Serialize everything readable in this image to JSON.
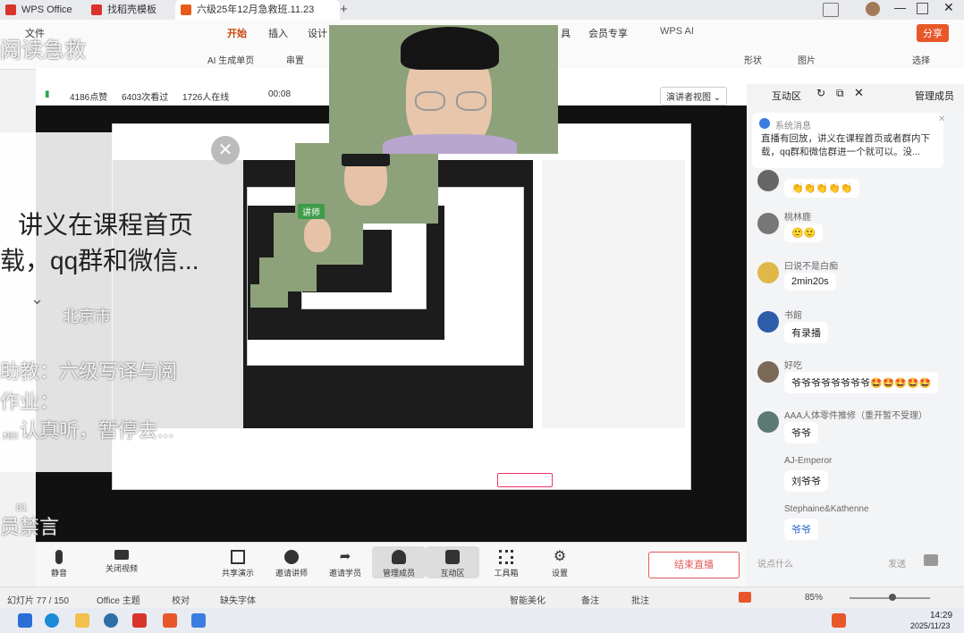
{
  "wps_tabs": [
    {
      "label": "WPS Office",
      "color": "#d9342b"
    },
    {
      "label": "找稻壳模板",
      "color": "#d9342b"
    },
    {
      "label": "六级25年12月急救班.11.23",
      "color": "#e85a1b"
    }
  ],
  "ribbon": {
    "menu_label": "文件",
    "tabs": [
      "开始",
      "插入",
      "设计",
      "具",
      "会员专享",
      "WPS AI"
    ],
    "tools": [
      "AI 生成单页",
      "串置",
      "形状",
      "图片",
      "选择"
    ],
    "share": "分享"
  },
  "live": {
    "likes": "4186点赞",
    "views": "6403次看过",
    "online": "1726人在线",
    "timer": "00:08",
    "view_mode": "演讲者视图",
    "panel_title": "互动区",
    "members_tab": "管理成员"
  },
  "teacher_tag": "讲师",
  "overlay": {
    "title_fragment": "阅读急救",
    "line1": "讲义在课程首页",
    "line2": "载，qq群和微信...",
    "ghost_city": "北京市",
    "ghost_line1": "助教：六级写译与阅",
    "ghost_line2": "作业：",
    "ghost_line3": "，认真听，暂停去...",
    "ghost_muted": "员禁言",
    "ghost_num1": "80",
    "ghost_num2": "81"
  },
  "system_msg": {
    "label": "系统消息",
    "text": "直播有回放，讲义在课程首页或者群内下载，qq群和微信群进一个就可以。没..."
  },
  "chat": [
    {
      "name": "",
      "text": "👏👏👏👏👏",
      "avatar": "#666"
    },
    {
      "name": "桃林鹿",
      "text": "🙂🙂",
      "avatar": "#777"
    },
    {
      "name": "曰说不是白痴",
      "text": "2min20s",
      "avatar": "#e0b84a"
    },
    {
      "name": "书館",
      "text": "有录播",
      "avatar": "#2d5ca8"
    },
    {
      "name": "好吃",
      "text": "爷爷爷爷爷爷爷爷🤩🤩🤩🤩🤩",
      "avatar": "#7a6a55"
    },
    {
      "name": "AAA人体零件推修（重开暂不受理）",
      "text": "爷爷",
      "avatar": "#5b7a72"
    },
    {
      "name": "AJ-Emperor",
      "text": "刘爷爷",
      "avatar": "#f3f4f6"
    },
    {
      "name": "Stephaine&Kathenne",
      "text": "爷爷",
      "avatar": "#f3f4f6"
    }
  ],
  "controls": [
    {
      "label": "静音",
      "icon": "mic-icon"
    },
    {
      "label": "关闭视频",
      "icon": "camera-icon"
    },
    {
      "label": "共享演示",
      "icon": "share-screen-icon"
    },
    {
      "label": "邀请讲师",
      "icon": "invite-teacher-icon"
    },
    {
      "label": "邀请学员",
      "icon": "invite-student-icon"
    },
    {
      "label": "管理成员",
      "icon": "members-icon"
    },
    {
      "label": "互动区",
      "icon": "chat-icon"
    },
    {
      "label": "工具箱",
      "icon": "toolbox-icon"
    },
    {
      "label": "设置",
      "icon": "settings-icon"
    }
  ],
  "end_live": "结束直播",
  "input_placeholder": "说点什么",
  "input_send": "发送",
  "status": {
    "slide": "幻灯片 77 / 150",
    "theme": "Office 主题",
    "proof": "校对",
    "missing_font": "缺失字体",
    "beautify": "智能美化",
    "notes": "备注",
    "annot": "批注",
    "zoom": "85%"
  },
  "clock": {
    "time": "14:29",
    "date": "2025/11/23"
  }
}
